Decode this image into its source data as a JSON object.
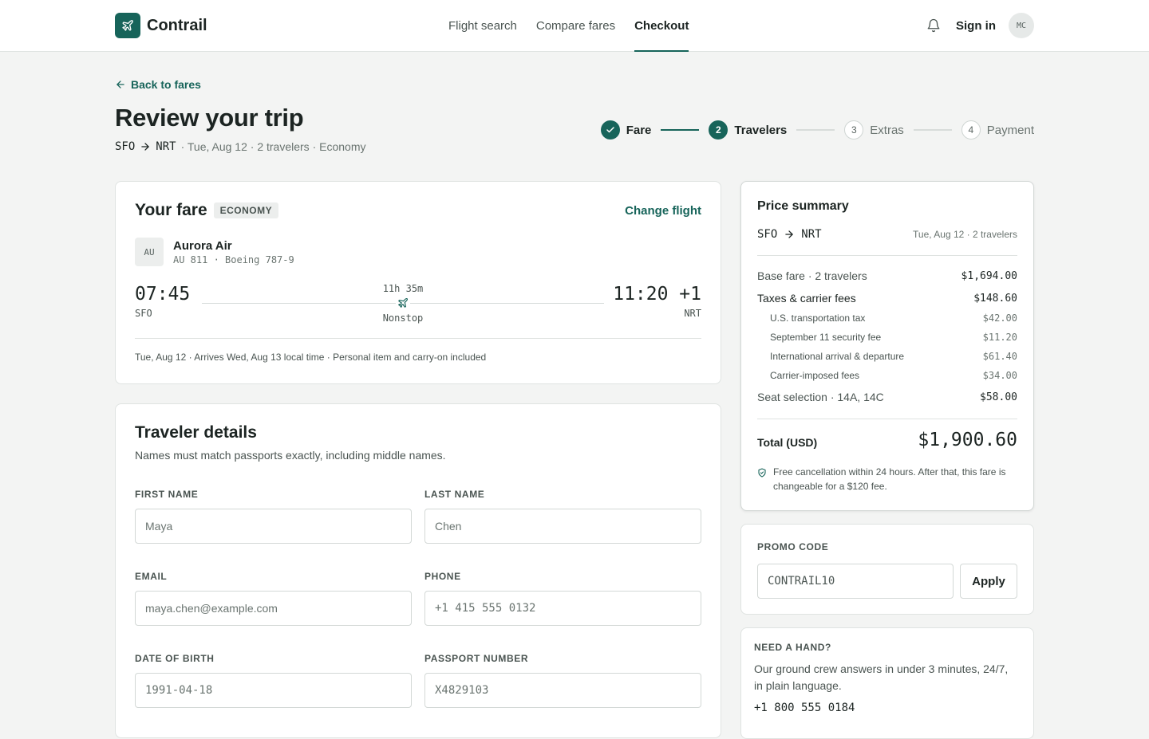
{
  "brand": {
    "name": "Contrail",
    "logo_icon": "plane-icon",
    "accent": "#17645a"
  },
  "nav": [
    {
      "label": "Flight search",
      "active": false
    },
    {
      "label": "Compare fares",
      "active": false
    },
    {
      "label": "Checkout",
      "active": true
    }
  ],
  "header": {
    "signin_label": "Sign in",
    "avatar_initials": "MC"
  },
  "page": {
    "back_label": "Back to fares",
    "title": "Review your trip",
    "origin": "SFO",
    "destination": "NRT",
    "trip_meta": "· Tue, Aug 12 · 2 travelers · Economy"
  },
  "stepper": [
    {
      "label": "Fare",
      "state": "done",
      "number": "1"
    },
    {
      "label": "Travelers",
      "state": "current",
      "number": "2"
    },
    {
      "label": "Extras",
      "state": "todo",
      "number": "3"
    },
    {
      "label": "Payment",
      "state": "todo",
      "number": "4"
    }
  ],
  "fare": {
    "title": "Your fare",
    "cabin_badge": "ECONOMY",
    "change_label": "Change flight",
    "airline_code": "AU",
    "airline_name": "Aurora Air",
    "flight_info": "AU 811 · Boeing 787-9",
    "depart_time": "07:45",
    "depart_code": "SFO",
    "arrive_time": "11:20 +1",
    "arrive_code": "NRT",
    "duration": "11h 35m",
    "stops": "Nonstop",
    "note": "Tue, Aug 12 · Arrives Wed, Aug 13 local time · Personal item and carry-on included"
  },
  "travelers": {
    "title": "Traveler details",
    "subtitle": "Names must match passports exactly, including middle names.",
    "fields": {
      "first_name": {
        "label": "FIRST NAME",
        "value": "Maya"
      },
      "last_name": {
        "label": "LAST NAME",
        "value": "Chen"
      },
      "email": {
        "label": "EMAIL",
        "value": "maya.chen@example.com"
      },
      "phone": {
        "label": "PHONE",
        "value": "+1 415 555 0132"
      },
      "dob": {
        "label": "DATE OF BIRTH",
        "value": "1991-04-18"
      },
      "passport": {
        "label": "PASSPORT NUMBER",
        "value": "X4829103"
      }
    }
  },
  "price_summary": {
    "title": "Price summary",
    "origin": "SFO",
    "destination": "NRT",
    "date_travelers": "Tue, Aug 12 · 2 travelers",
    "base_fare": {
      "label": "Base fare · 2 travelers",
      "value": "$1,694.00"
    },
    "taxes": {
      "label": "Taxes & carrier fees",
      "value": "$148.60"
    },
    "tax_items": [
      {
        "label": "U.S. transportation tax",
        "value": "$42.00"
      },
      {
        "label": "September 11 security fee",
        "value": "$11.20"
      },
      {
        "label": "International arrival & departure",
        "value": "$61.40"
      },
      {
        "label": "Carrier-imposed fees",
        "value": "$34.00"
      }
    ],
    "seats": {
      "label": "Seat selection · 14A, 14C",
      "value": "$58.00"
    },
    "total_label": "Total (USD)",
    "total_value": "$1,900.60",
    "cancel_note": "Free cancellation within 24 hours. After that, this fare is changeable for a $120 fee."
  },
  "promo": {
    "label": "PROMO CODE",
    "value": "CONTRAIL10",
    "apply_label": "Apply"
  },
  "help": {
    "label": "NEED A HAND?",
    "text": "Our ground crew answers in under 3 minutes, 24/7, in plain language.",
    "phone": "+1 800 555 0184"
  }
}
